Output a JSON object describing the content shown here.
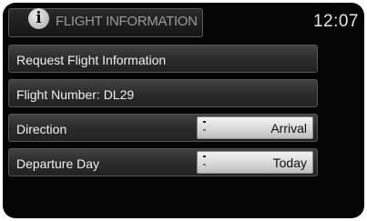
{
  "header": {
    "icon": "info-icon",
    "icon_glyph": "i",
    "title": "FLIGHT INFORMATION",
    "clock": "12:07"
  },
  "menu": {
    "request_flight_label": "Request Flight Information",
    "flight_number_label": "Flight Number: DL29",
    "direction": {
      "label": "Direction",
      "value": "Arrival"
    },
    "departure_day": {
      "label": "Departure Day",
      "value": "Today"
    }
  }
}
